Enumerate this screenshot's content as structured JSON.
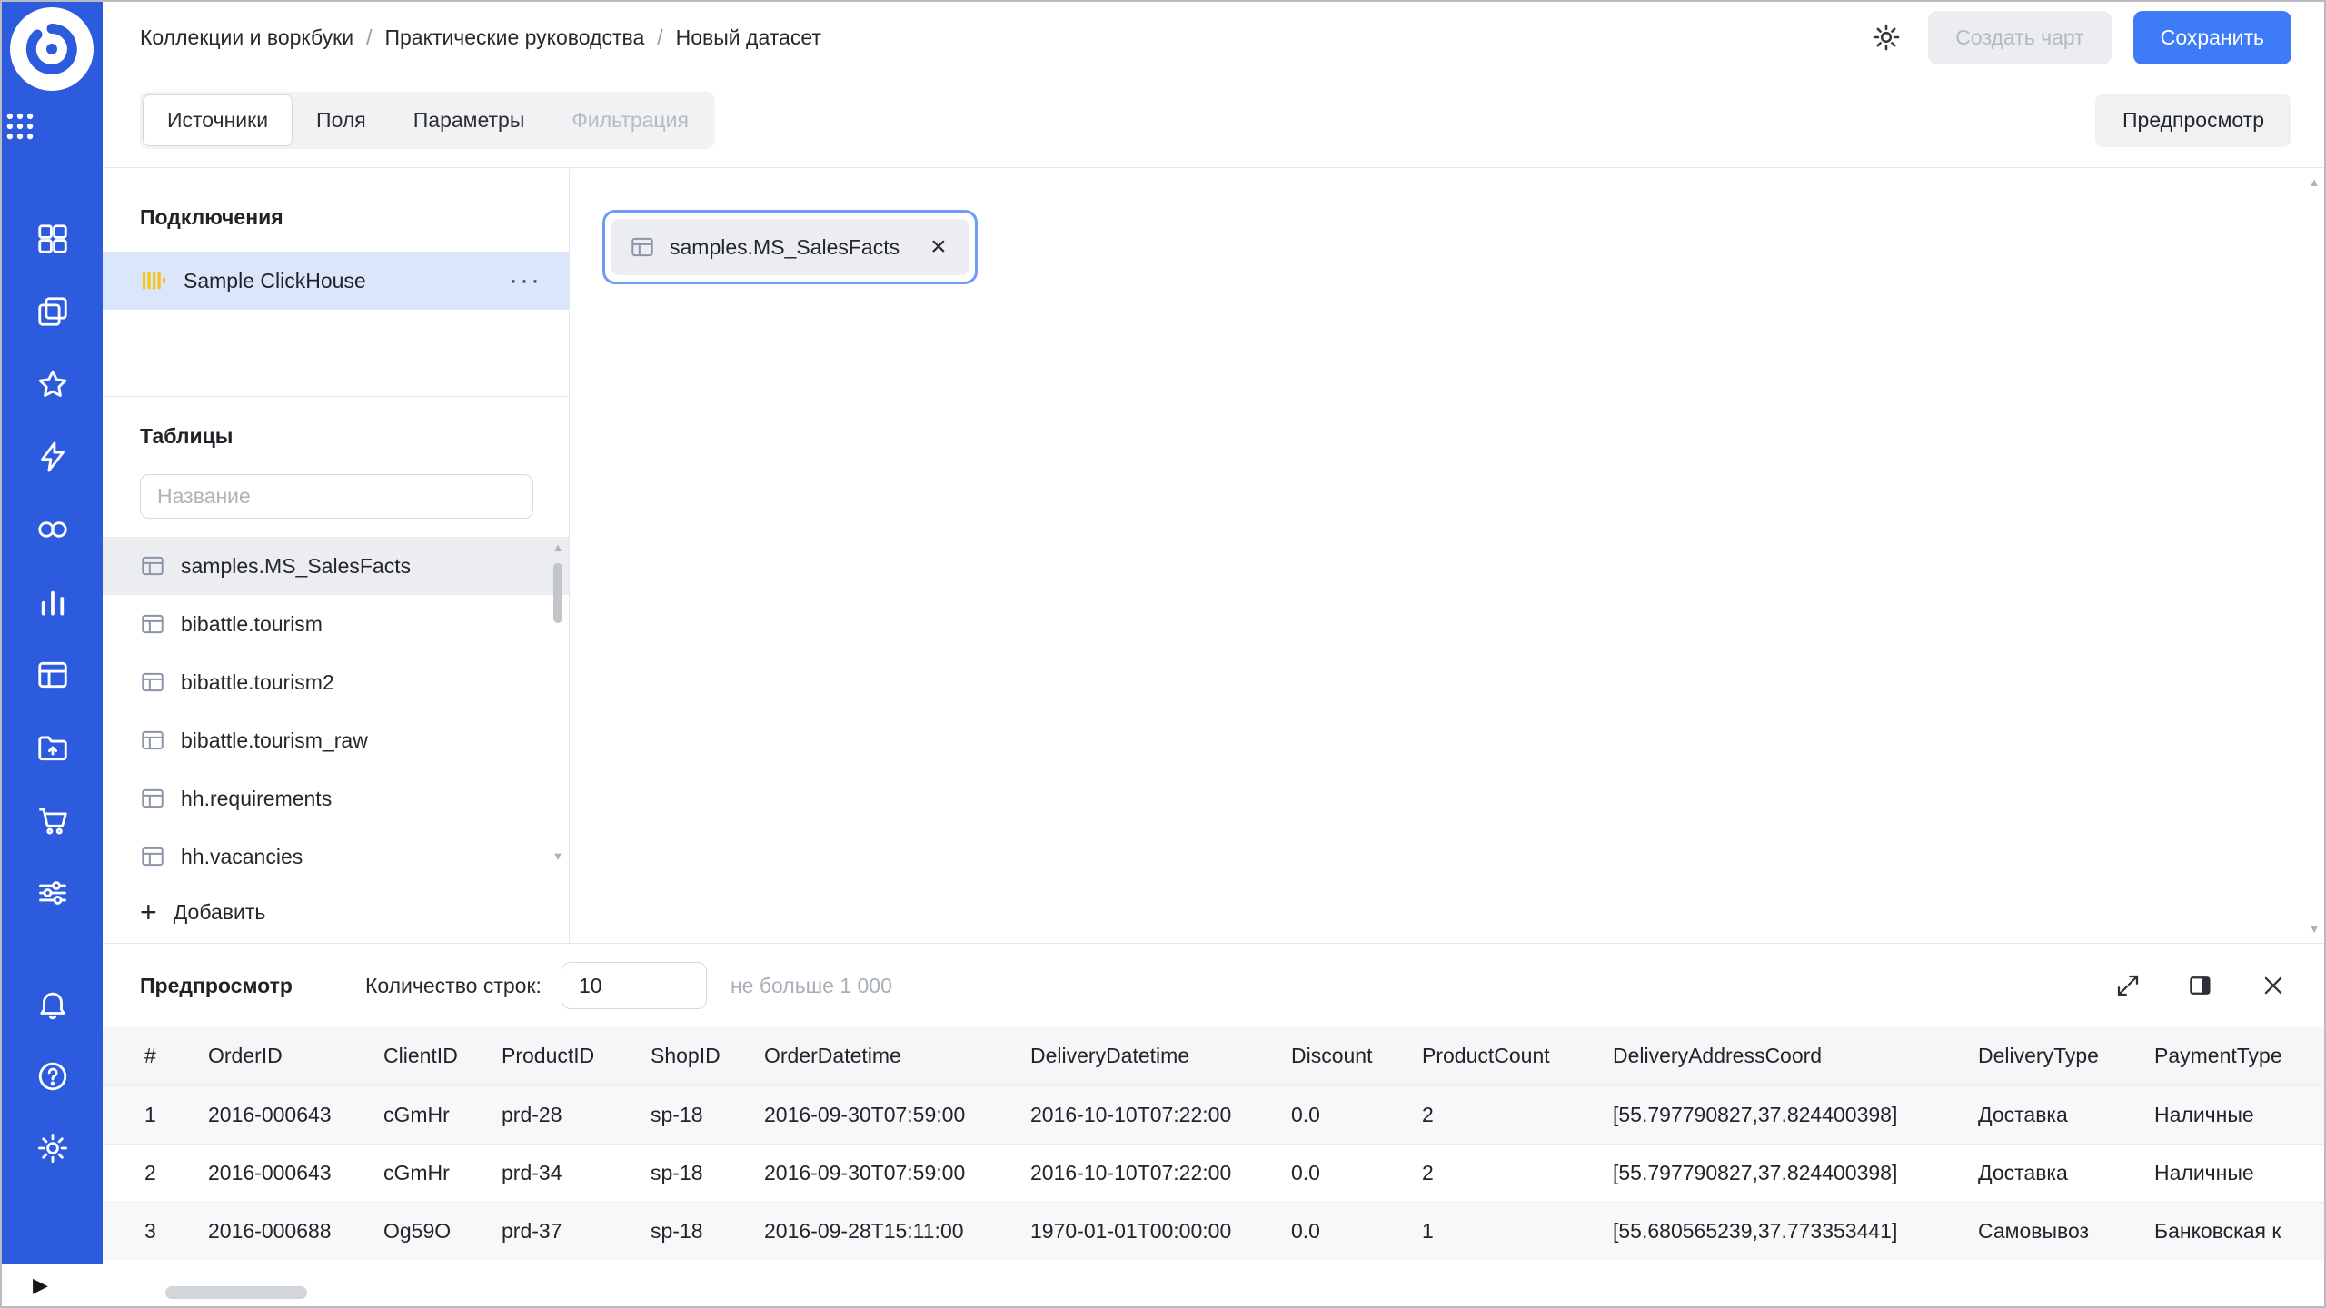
{
  "header": {
    "breadcrumbs": [
      "Коллекции и воркбуки",
      "Практические руководства",
      "Новый датасет"
    ],
    "breadcrumb_separator": "/",
    "buttons": {
      "create_chart": "Создать чарт",
      "save": "Сохранить"
    }
  },
  "toolbar": {
    "tabs": [
      {
        "label": "Источники",
        "state": "active"
      },
      {
        "label": "Поля",
        "state": "default"
      },
      {
        "label": "Параметры",
        "state": "default"
      },
      {
        "label": "Фильтрация",
        "state": "disabled"
      }
    ],
    "preview_button": "Предпросмотр"
  },
  "connections_panel": {
    "title": "Подключения",
    "connection_name": "Sample ClickHouse",
    "more_glyph": "···",
    "tables_title": "Таблицы",
    "search_placeholder": "Название",
    "tables": [
      {
        "name": "samples.MS_SalesFacts",
        "selected": true
      },
      {
        "name": "bibattle.tourism",
        "selected": false
      },
      {
        "name": "bibattle.tourism2",
        "selected": false
      },
      {
        "name": "bibattle.tourism_raw",
        "selected": false
      },
      {
        "name": "hh.requirements",
        "selected": false
      },
      {
        "name": "hh.vacancies",
        "selected": false
      }
    ],
    "add_button": "Добавить",
    "add_glyph": "+"
  },
  "canvas": {
    "selected_table_chip": "samples.MS_SalesFacts",
    "chip_close_glyph": "×"
  },
  "preview": {
    "title": "Предпросмотр",
    "row_count_label": "Количество строк:",
    "row_count_value": "10",
    "row_count_hint": "не больше 1 000",
    "columns": [
      "#",
      "OrderID",
      "ClientID",
      "ProductID",
      "ShopID",
      "OrderDatetime",
      "DeliveryDatetime",
      "Discount",
      "ProductCount",
      "DeliveryAddressCoord",
      "DeliveryType",
      "PaymentType"
    ],
    "rows": [
      [
        "1",
        "2016-000643",
        "cGmHr",
        "prd-28",
        "sp-18",
        "2016-09-30T07:59:00",
        "2016-10-10T07:22:00",
        "0.0",
        "2",
        "[55.797790827,37.824400398]",
        "Доставка",
        "Наличные"
      ],
      [
        "2",
        "2016-000643",
        "cGmHr",
        "prd-34",
        "sp-18",
        "2016-09-30T07:59:00",
        "2016-10-10T07:22:00",
        "0.0",
        "2",
        "[55.797790827,37.824400398]",
        "Доставка",
        "Наличные"
      ],
      [
        "3",
        "2016-000688",
        "Og59O",
        "prd-37",
        "sp-18",
        "2016-09-28T15:11:00",
        "1970-01-01T00:00:00",
        "0.0",
        "1",
        "[55.680565239,37.773353441]",
        "Самовывоз",
        "Банковская к"
      ]
    ]
  },
  "scrollbar": {
    "up": "▲",
    "down": "▼",
    "collapse": "▶"
  },
  "colors": {
    "sidebar": "#2d5bdd",
    "primary_button": "#3e7bf7",
    "selected_connection_bg": "#dbe6fb",
    "selected_table_bg": "#ebedf0",
    "chip_ring": "#6f9bf7",
    "clickhouse_yellow": "#f5c31d"
  }
}
